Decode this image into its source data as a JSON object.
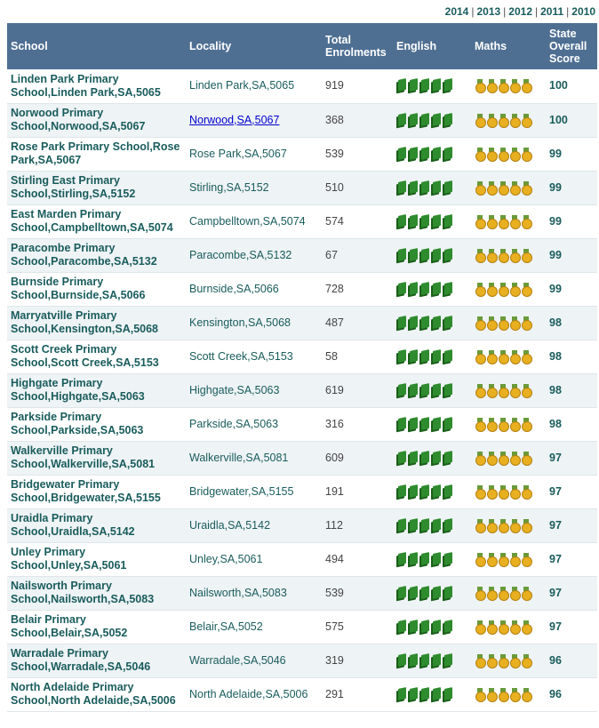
{
  "years": [
    "2014",
    "2013",
    "2012",
    "2011",
    "2010"
  ],
  "headers": {
    "school": "School",
    "locality": "Locality",
    "enrol_line1": "Total",
    "enrol_line2": "Enrolments",
    "english": "English",
    "maths": "Maths",
    "score_line1": "State",
    "score_line2": "Overall",
    "score_line3": "Score"
  },
  "rows": [
    {
      "school": "Linden Park Primary School,Linden Park,SA,5065",
      "locality": "Linden Park,SA,5065",
      "enrolments": "919",
      "english": 5,
      "maths": 5,
      "score": "100",
      "locality_link": false
    },
    {
      "school": "Norwood Primary School,Norwood,SA,5067",
      "locality": "Norwood,SA,5067",
      "enrolments": "368",
      "english": 5,
      "maths": 5,
      "score": "100",
      "locality_link": true
    },
    {
      "school": "Rose Park Primary School,Rose Park,SA,5067",
      "locality": "Rose Park,SA,5067",
      "enrolments": "539",
      "english": 5,
      "maths": 5,
      "score": "99",
      "locality_link": false
    },
    {
      "school": "Stirling East Primary School,Stirling,SA,5152",
      "locality": "Stirling,SA,5152",
      "enrolments": "510",
      "english": 5,
      "maths": 5,
      "score": "99",
      "locality_link": false
    },
    {
      "school": "East Marden Primary School,Campbelltown,SA,5074",
      "locality": "Campbelltown,SA,5074",
      "enrolments": "574",
      "english": 5,
      "maths": 5,
      "score": "99",
      "locality_link": false
    },
    {
      "school": "Paracombe Primary School,Paracombe,SA,5132",
      "locality": "Paracombe,SA,5132",
      "enrolments": "67",
      "english": 5,
      "maths": 5,
      "score": "99",
      "locality_link": false
    },
    {
      "school": "Burnside Primary School,Burnside,SA,5066",
      "locality": "Burnside,SA,5066",
      "enrolments": "728",
      "english": 5,
      "maths": 5,
      "score": "99",
      "locality_link": false
    },
    {
      "school": "Marryatville Primary School,Kensington,SA,5068",
      "locality": "Kensington,SA,5068",
      "enrolments": "487",
      "english": 5,
      "maths": 5,
      "score": "98",
      "locality_link": false
    },
    {
      "school": "Scott Creek Primary School,Scott Creek,SA,5153",
      "locality": "Scott Creek,SA,5153",
      "enrolments": "58",
      "english": 5,
      "maths": 5,
      "score": "98",
      "locality_link": false
    },
    {
      "school": "Highgate Primary School,Highgate,SA,5063",
      "locality": "Highgate,SA,5063",
      "enrolments": "619",
      "english": 5,
      "maths": 5,
      "score": "98",
      "locality_link": false
    },
    {
      "school": "Parkside Primary School,Parkside,SA,5063",
      "locality": "Parkside,SA,5063",
      "enrolments": "316",
      "english": 5,
      "maths": 5,
      "score": "98",
      "locality_link": false
    },
    {
      "school": "Walkerville Primary School,Walkerville,SA,5081",
      "locality": "Walkerville,SA,5081",
      "enrolments": "609",
      "english": 5,
      "maths": 5,
      "score": "97",
      "locality_link": false
    },
    {
      "school": "Bridgewater Primary School,Bridgewater,SA,5155",
      "locality": "Bridgewater,SA,5155",
      "enrolments": "191",
      "english": 5,
      "maths": 5,
      "score": "97",
      "locality_link": false
    },
    {
      "school": "Uraidla Primary School,Uraidla,SA,5142",
      "locality": "Uraidla,SA,5142",
      "enrolments": "112",
      "english": 5,
      "maths": 5,
      "score": "97",
      "locality_link": false
    },
    {
      "school": "Unley Primary School,Unley,SA,5061",
      "locality": "Unley,SA,5061",
      "enrolments": "494",
      "english": 5,
      "maths": 5,
      "score": "97",
      "locality_link": false
    },
    {
      "school": "Nailsworth Primary School,Nailsworth,SA,5083",
      "locality": "Nailsworth,SA,5083",
      "enrolments": "539",
      "english": 5,
      "maths": 5,
      "score": "97",
      "locality_link": false
    },
    {
      "school": "Belair Primary School,Belair,SA,5052",
      "locality": "Belair,SA,5052",
      "enrolments": "575",
      "english": 5,
      "maths": 5,
      "score": "97",
      "locality_link": false
    },
    {
      "school": "Warradale Primary School,Warradale,SA,5046",
      "locality": "Warradale,SA,5046",
      "enrolments": "319",
      "english": 5,
      "maths": 5,
      "score": "96",
      "locality_link": false
    },
    {
      "school": "North Adelaide Primary School,North Adelaide,SA,5006",
      "locality": "North Adelaide,SA,5006",
      "enrolments": "291",
      "english": 5,
      "maths": 5,
      "score": "96",
      "locality_link": false
    }
  ],
  "icons": {
    "english": "book-icon",
    "maths": "medal-icon"
  },
  "colors": {
    "header_bg": "#4e6f92",
    "text_teal": "#1a5c5c",
    "link_blue": "#0000cc",
    "book_green": "#2e8b2e",
    "medal_gold": "#e8b020"
  }
}
